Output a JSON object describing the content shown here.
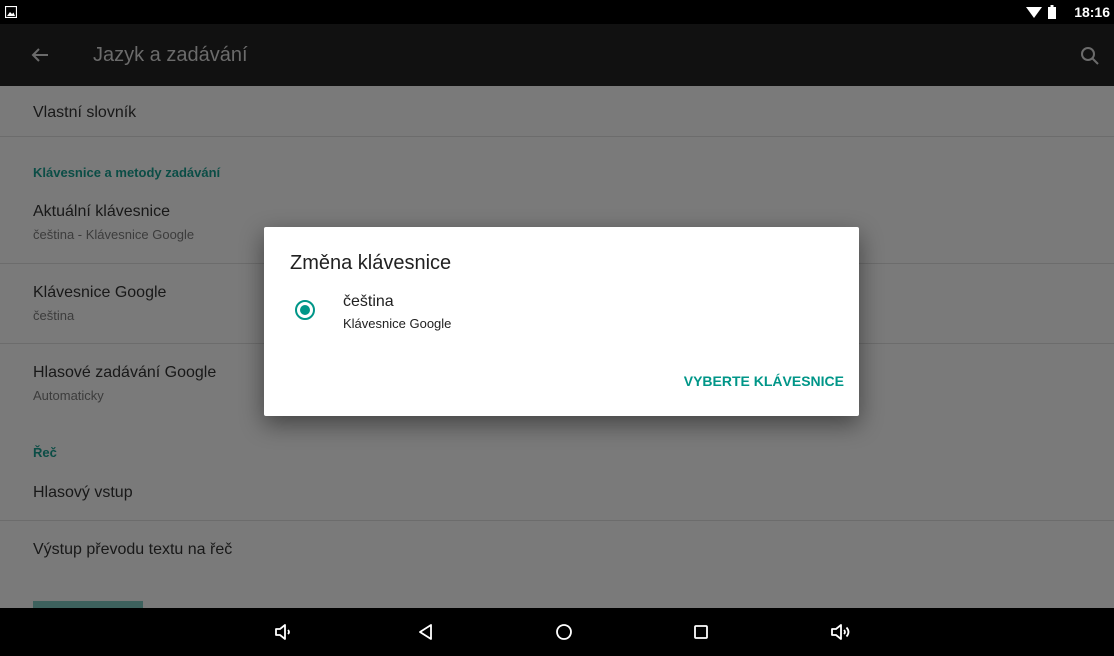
{
  "status_bar": {
    "time": "18:16",
    "icons": [
      "notification-image-icon",
      "wifi-icon",
      "battery-icon"
    ]
  },
  "app_bar": {
    "title": "Jazyk a zadávání",
    "icons": [
      "back-arrow-icon",
      "search-icon"
    ]
  },
  "settings": {
    "custom_dictionary": "Vlastní slovník",
    "category_keyboards": "Klávesnice a metody zadávání",
    "current_keyboard": {
      "title": "Aktuální klávesnice",
      "summary": "čeština - Klávesnice Google"
    },
    "google_keyboard": {
      "title": "Klávesnice Google",
      "summary": "čeština"
    },
    "google_voice": {
      "title": "Hlasové zadávání Google",
      "summary": "Automaticky"
    },
    "category_speech": "Řeč",
    "voice_input": "Hlasový vstup",
    "tts_output": "Výstup převodu textu na řeč"
  },
  "dialog": {
    "title": "Změna klávesnice",
    "option": {
      "title": "čeština",
      "subtitle": "Klávesnice Google",
      "selected": true
    },
    "action": "VYBERTE KLÁVESNICE"
  },
  "nav_bar": {
    "icons": [
      "volume-down-icon",
      "back-icon",
      "home-icon",
      "recents-icon",
      "volume-up-icon"
    ]
  },
  "colors": {
    "accent": "#009688",
    "scrim_content": "#7a7a7a",
    "app_bar": "#111111"
  }
}
